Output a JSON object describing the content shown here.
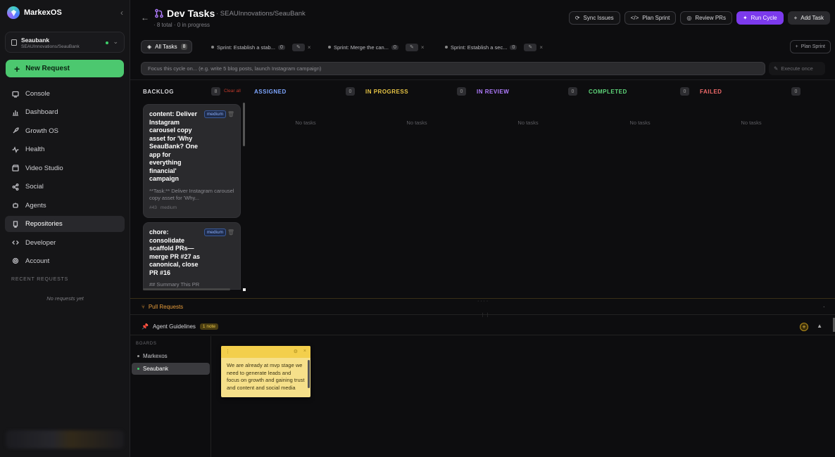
{
  "app": {
    "name": "MarkexOS"
  },
  "repo": {
    "name": "Seaubank",
    "path": "SEAUInnovations/SeauBank"
  },
  "sidebar": {
    "new_request": "New Request",
    "items": [
      {
        "label": "Console"
      },
      {
        "label": "Dashboard"
      },
      {
        "label": "Growth OS"
      },
      {
        "label": "Health"
      },
      {
        "label": "Video Studio"
      },
      {
        "label": "Social"
      },
      {
        "label": "Agents"
      },
      {
        "label": "Repositories"
      },
      {
        "label": "Developer"
      },
      {
        "label": "Account"
      }
    ],
    "recent_heading": "RECENT REQUESTS",
    "recent_empty": "No requests yet"
  },
  "header": {
    "title": "Dev Tasks",
    "subtitle": "· SEAUInnovations/SeauBank",
    "meta": "· 8 total · 0 in progress",
    "buttons": {
      "sync": "Sync Issues",
      "plan": "Plan Sprint",
      "review": "Review PRs",
      "run": "Run Cycle",
      "add": "Add Task"
    }
  },
  "tabs": {
    "all_label": "All Tasks",
    "all_count": "8",
    "sprints": [
      {
        "label": "Sprint: Establish a stab...",
        "count": "0"
      },
      {
        "label": "Sprint: Merge the can...",
        "count": "0"
      },
      {
        "label": "Sprint: Establish a sec...",
        "count": "0"
      }
    ],
    "plan_sprint": "Plan Sprint"
  },
  "focus": {
    "placeholder": "Focus this cycle on... (e.g. write 5 blog posts, launch Instagram campaign)",
    "execute": "Execute once"
  },
  "columns": {
    "backlog": {
      "label": "BACKLOG",
      "count": "8",
      "clear": "Clear all"
    },
    "assigned": {
      "label": "ASSIGNED",
      "count": "0",
      "empty": "No tasks"
    },
    "in_progress": {
      "label": "IN PROGRESS",
      "count": "0",
      "empty": "No tasks"
    },
    "in_review": {
      "label": "IN REVIEW",
      "count": "0",
      "empty": "No tasks"
    },
    "completed": {
      "label": "COMPLETED",
      "count": "0",
      "empty": "No tasks"
    },
    "failed": {
      "label": "FAILED",
      "count": "0",
      "empty": "No tasks"
    }
  },
  "cards": [
    {
      "title": "content: Deliver Instagram carousel copy asset for 'Why SeauBank? One app for everything financial' campaign",
      "priority": "medium",
      "desc": "**Task:** Deliver Instagram carousel copy asset for 'Why...",
      "num": "#43",
      "tag": "medium"
    },
    {
      "title": "chore: consolidate scaffold PRs—merge PR #27 as canonical, close PR #16",
      "priority": "medium",
      "desc": "## Summary This PR"
    }
  ],
  "pull_requests": {
    "label": "Pull Requests"
  },
  "guidelines": {
    "label": "Agent Guidelines",
    "badge": "1 note",
    "boards_heading": "BOARDS",
    "boards": [
      {
        "label": "Markexos"
      },
      {
        "label": "Seaubank"
      }
    ],
    "note": "We are already at mvp stage we need to generate leads and focus on growth and gaining trust and content and social media"
  },
  "colors": {
    "accent": "#7c3aed",
    "green": "#4cc86f",
    "assigned": "#7ea6ff",
    "in_progress": "#e8c545",
    "in_review": "#b07cff",
    "completed": "#5fd67a",
    "failed": "#f06a6a"
  }
}
